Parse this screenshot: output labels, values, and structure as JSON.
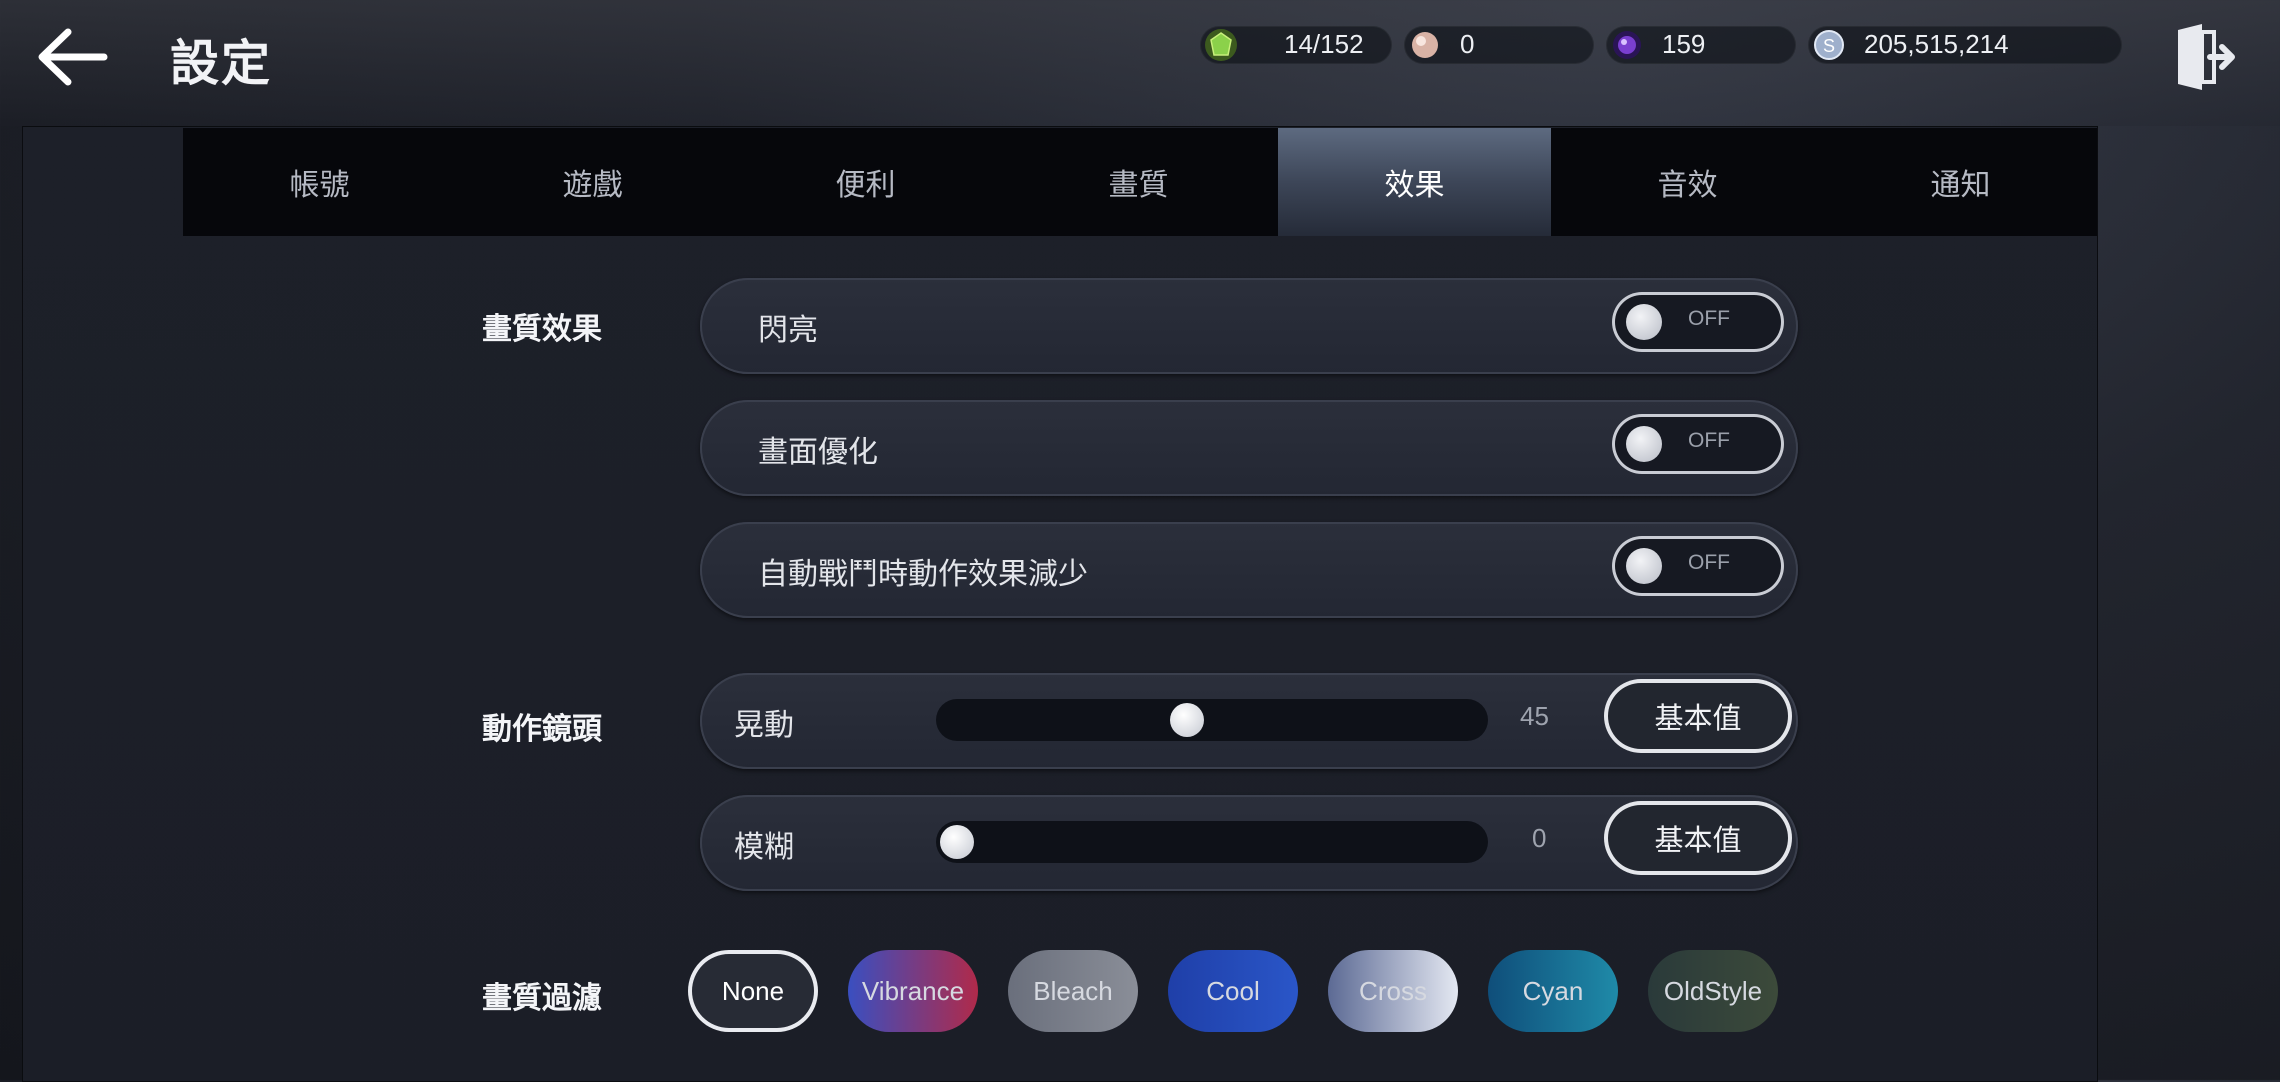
{
  "header": {
    "title": "設定",
    "currencies": [
      {
        "icon": "green-gem-icon",
        "value": "14/152",
        "color": "#7fbf3a"
      },
      {
        "icon": "pearl-icon",
        "value": "0",
        "color": "#e0b8a8"
      },
      {
        "icon": "purple-orb-icon",
        "value": "159",
        "color": "#7a3fd0"
      },
      {
        "icon": "silver-coin-icon",
        "value": "205,515,214",
        "color": "#b8c4d8"
      }
    ]
  },
  "tabs": [
    {
      "label": "帳號",
      "active": false
    },
    {
      "label": "遊戲",
      "active": false
    },
    {
      "label": "便利",
      "active": false
    },
    {
      "label": "畫質",
      "active": false
    },
    {
      "label": "效果",
      "active": true
    },
    {
      "label": "音效",
      "active": false
    },
    {
      "label": "通知",
      "active": false
    }
  ],
  "sections": {
    "quality_effects": {
      "label": "畫質效果",
      "items": [
        {
          "label": "閃亮",
          "state": "OFF"
        },
        {
          "label": "畫面優化",
          "state": "OFF"
        },
        {
          "label": "自動戰鬥時動作效果減少",
          "state": "OFF"
        }
      ]
    },
    "action_camera": {
      "label": "動作鏡頭",
      "items": [
        {
          "label": "晃動",
          "value": 45,
          "max": 100,
          "reset_label": "基本值"
        },
        {
          "label": "模糊",
          "value": 0,
          "max": 100,
          "reset_label": "基本值"
        }
      ]
    },
    "filters": {
      "label": "畫質過濾",
      "selected": "None",
      "options": [
        {
          "label": "None",
          "bg": "#272b35"
        },
        {
          "label": "Vibrance",
          "bg": "linear-gradient(90deg,#3a4fc0,#b02a4a)"
        },
        {
          "label": "Bleach",
          "bg": "linear-gradient(90deg,#6a6f7c,#8a8e98)"
        },
        {
          "label": "Cool",
          "bg": "linear-gradient(90deg,#1f3fa8,#2a56c8)"
        },
        {
          "label": "Cross",
          "bg": "linear-gradient(90deg,#5c6a94,#e4e8f2)"
        },
        {
          "label": "Cyan",
          "bg": "linear-gradient(90deg,#0f4e7a,#1f8aa8)"
        },
        {
          "label": "OldStyle",
          "bg": "linear-gradient(90deg,#2a3a3a,#3c4a3a)"
        }
      ]
    }
  }
}
